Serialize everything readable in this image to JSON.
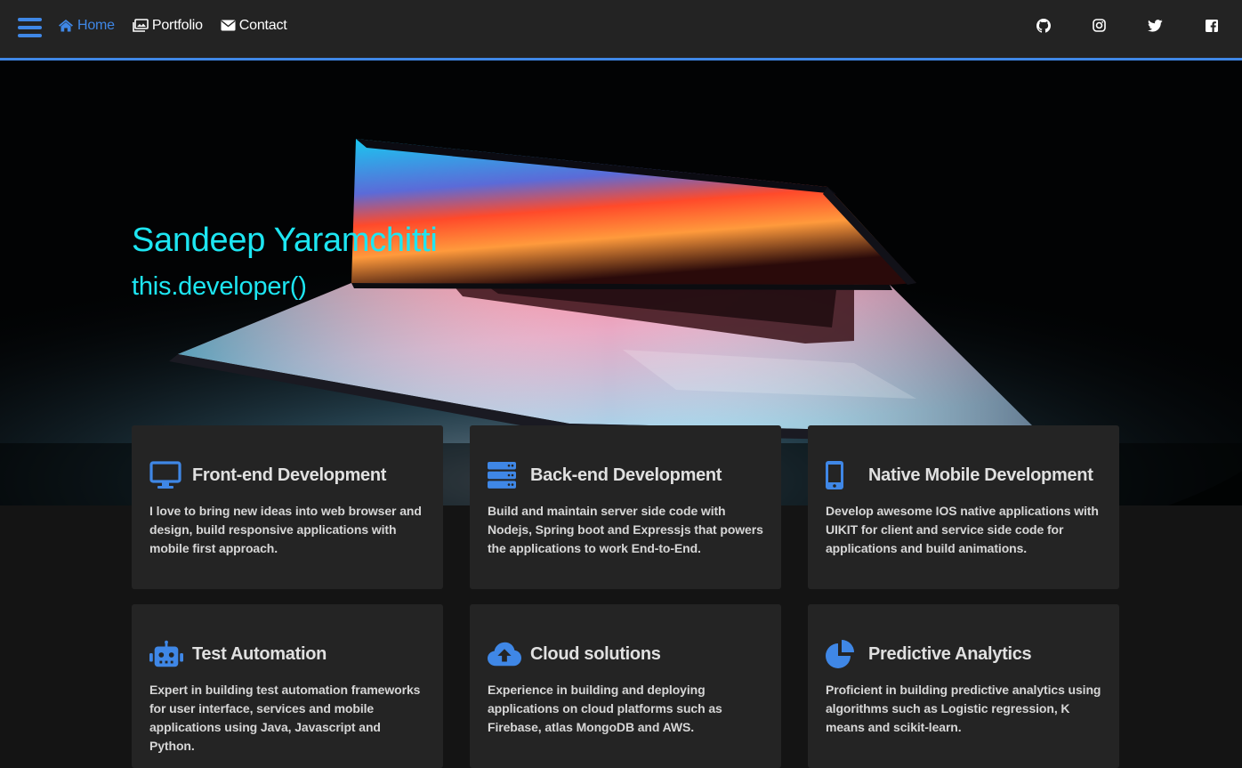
{
  "nav": {
    "links": [
      {
        "label": "Home",
        "icon": "home-icon",
        "active": true
      },
      {
        "label": "Portfolio",
        "icon": "image-icon",
        "active": false
      },
      {
        "label": "Contact",
        "icon": "envelope-icon",
        "active": false
      }
    ],
    "social": [
      "github-icon",
      "instagram-icon",
      "twitter-icon",
      "facebook-icon"
    ],
    "accent_color": "#3f87e6"
  },
  "hero": {
    "name": "Sandeep Yaramchitti",
    "tagline": "this.developer()",
    "text_color": "#1de6f2"
  },
  "services": [
    {
      "icon": "monitor-icon",
      "title": "Front-end Development",
      "text": "I love to bring new ideas into web browser and design, build responsive applications with mobile first approach."
    },
    {
      "icon": "server-icon",
      "title": "Back-end Development",
      "text": "Build and maintain server side code with Nodejs, Spring boot and Expressjs that powers the applications to work End-to-End."
    },
    {
      "icon": "mobile-icon",
      "title": "Native Mobile Development",
      "text": "Develop awesome IOS native applications with UIKIT for client and service side code for applications and build animations."
    },
    {
      "icon": "robot-icon",
      "title": "Test Automation",
      "text": "Expert in building test automation frameworks for user interface, services and mobile applications using Java, Javascript and Python."
    },
    {
      "icon": "cloud-upload-icon",
      "title": "Cloud solutions",
      "text": "Experience in building and deploying applications on cloud platforms such as Firebase, atlas MongoDB and AWS."
    },
    {
      "icon": "pie-chart-icon",
      "title": "Predictive Analytics",
      "text": "Proficient in building predictive analytics using algorithms such as Logistic regression, K means and scikit-learn."
    }
  ]
}
